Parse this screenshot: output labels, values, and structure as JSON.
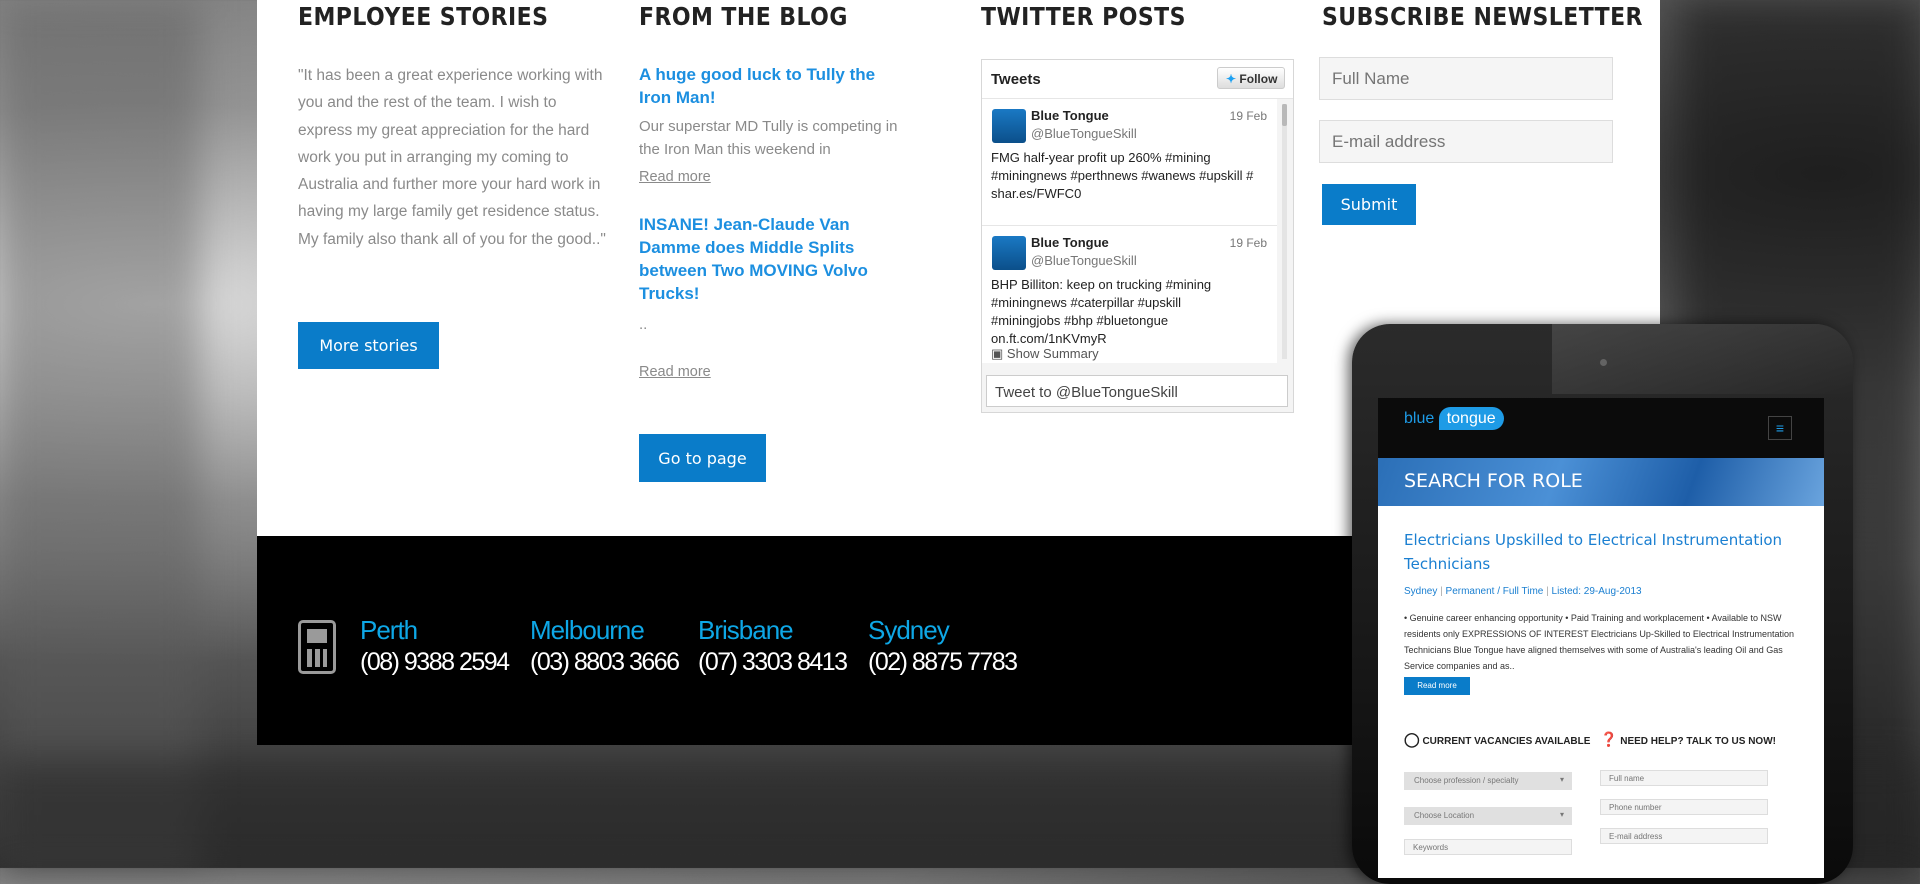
{
  "columns": {
    "employee_title": "EMPLOYEE STORIES",
    "blog_title": "FROM THE BLOG",
    "twitter_title": "TWITTER POSTS",
    "newsletter_title": "SUBSCRIBE NEWSLETTER"
  },
  "employee": {
    "quote": "\"It has been a great experience working with you and the rest of the team. I wish to express my great appreciation for the hard work you put in arranging my coming to Australia and further more your hard work in having my large family get residence status. My family also thank all of you for the good..\"",
    "button": "More stories"
  },
  "blog": {
    "posts": [
      {
        "title": "A huge good luck to Tully the Iron Man!",
        "excerpt": "Our superstar MD Tully is competing in the Iron Man this weekend in",
        "readmore": "Read more"
      },
      {
        "title": "INSANE! Jean-Claude Van Damme does Middle Splits between Two MOVING Volvo Trucks!",
        "excerpt": "..",
        "readmore": "Read more"
      }
    ],
    "button": "Go to page"
  },
  "twitter": {
    "header": "Tweets",
    "follow": "Follow",
    "tweets": [
      {
        "name": "Blue Tongue",
        "handle": "@BlueTongueSkill",
        "date": "19 Feb",
        "text": "FMG half-year profit up 260% #mining #miningnews #perthnews #wanews #upskill # shar.es/FWFC0"
      },
      {
        "name": "Blue Tongue",
        "handle": "@BlueTongueSkill",
        "date": "19 Feb",
        "text": "BHP Billiton: keep on trucking #mining #miningnews #caterpillar #upskill #miningjobs #bhp #bluetongue on.ft.com/1nKVmyR",
        "summary": "Show Summary"
      }
    ],
    "tweet_to": "Tweet to @BlueTongueSkill"
  },
  "newsletter": {
    "name_placeholder": "Full Name",
    "email_placeholder": "E-mail address",
    "submit": "Submit"
  },
  "footer": {
    "offices": [
      {
        "city": "Perth",
        "phone": "(08) 9388 2594"
      },
      {
        "city": "Melbourne",
        "phone": "(03) 8803 3666"
      },
      {
        "city": "Brisbane",
        "phone": "(07) 3303 8413"
      },
      {
        "city": "Sydney",
        "phone": "(02) 8875 7783"
      }
    ]
  },
  "tablet": {
    "logo_a": "blue",
    "logo_b": "tongue",
    "banner": "SEARCH FOR ROLE",
    "job_title": "Electricians Upskilled to Electrical Instrumentation Technicians",
    "meta_location": "Sydney",
    "meta_type": "Permanent / Full Time",
    "meta_listed": "Listed: 29-Aug-2013",
    "job_desc": "• Genuine career enhancing opportunity • Paid Training and workplacement • Available to NSW residents only EXPRESSIONS OF INTEREST Electricians Up-Skilled to Electrical Instrumentation Technicians Blue Tongue have aligned themselves with some of Australia's leading Oil and Gas Service companies and as..",
    "read_more": "Read more",
    "vacancies_title": "CURRENT VACANCIES AVAILABLE",
    "help_title": "NEED HELP? TALK TO US NOW!",
    "profession_select": "Choose profession / specialty",
    "location_select": "Choose Location",
    "keywords_placeholder": "Keywords",
    "fullname_placeholder": "Full name",
    "phone_placeholder": "Phone number",
    "email_placeholder": "E-mail address"
  }
}
